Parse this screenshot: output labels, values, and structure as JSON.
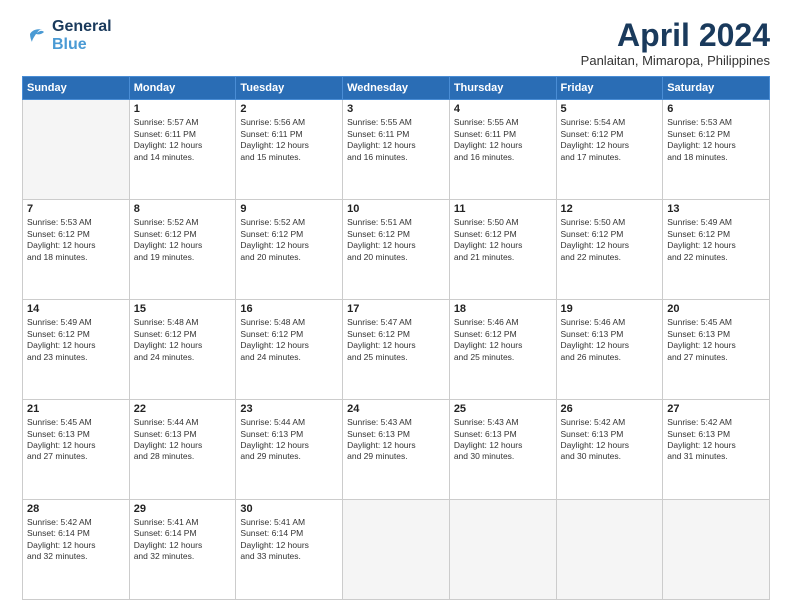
{
  "header": {
    "logo": {
      "line1": "General",
      "line2": "Blue"
    },
    "title": "April 2024",
    "location": "Panlaitan, Mimaropa, Philippines"
  },
  "weekdays": [
    "Sunday",
    "Monday",
    "Tuesday",
    "Wednesday",
    "Thursday",
    "Friday",
    "Saturday"
  ],
  "weeks": [
    [
      {
        "day": "",
        "info": ""
      },
      {
        "day": "1",
        "info": "Sunrise: 5:57 AM\nSunset: 6:11 PM\nDaylight: 12 hours\nand 14 minutes."
      },
      {
        "day": "2",
        "info": "Sunrise: 5:56 AM\nSunset: 6:11 PM\nDaylight: 12 hours\nand 15 minutes."
      },
      {
        "day": "3",
        "info": "Sunrise: 5:55 AM\nSunset: 6:11 PM\nDaylight: 12 hours\nand 16 minutes."
      },
      {
        "day": "4",
        "info": "Sunrise: 5:55 AM\nSunset: 6:11 PM\nDaylight: 12 hours\nand 16 minutes."
      },
      {
        "day": "5",
        "info": "Sunrise: 5:54 AM\nSunset: 6:12 PM\nDaylight: 12 hours\nand 17 minutes."
      },
      {
        "day": "6",
        "info": "Sunrise: 5:53 AM\nSunset: 6:12 PM\nDaylight: 12 hours\nand 18 minutes."
      }
    ],
    [
      {
        "day": "7",
        "info": "Sunrise: 5:53 AM\nSunset: 6:12 PM\nDaylight: 12 hours\nand 18 minutes."
      },
      {
        "day": "8",
        "info": "Sunrise: 5:52 AM\nSunset: 6:12 PM\nDaylight: 12 hours\nand 19 minutes."
      },
      {
        "day": "9",
        "info": "Sunrise: 5:52 AM\nSunset: 6:12 PM\nDaylight: 12 hours\nand 20 minutes."
      },
      {
        "day": "10",
        "info": "Sunrise: 5:51 AM\nSunset: 6:12 PM\nDaylight: 12 hours\nand 20 minutes."
      },
      {
        "day": "11",
        "info": "Sunrise: 5:50 AM\nSunset: 6:12 PM\nDaylight: 12 hours\nand 21 minutes."
      },
      {
        "day": "12",
        "info": "Sunrise: 5:50 AM\nSunset: 6:12 PM\nDaylight: 12 hours\nand 22 minutes."
      },
      {
        "day": "13",
        "info": "Sunrise: 5:49 AM\nSunset: 6:12 PM\nDaylight: 12 hours\nand 22 minutes."
      }
    ],
    [
      {
        "day": "14",
        "info": "Sunrise: 5:49 AM\nSunset: 6:12 PM\nDaylight: 12 hours\nand 23 minutes."
      },
      {
        "day": "15",
        "info": "Sunrise: 5:48 AM\nSunset: 6:12 PM\nDaylight: 12 hours\nand 24 minutes."
      },
      {
        "day": "16",
        "info": "Sunrise: 5:48 AM\nSunset: 6:12 PM\nDaylight: 12 hours\nand 24 minutes."
      },
      {
        "day": "17",
        "info": "Sunrise: 5:47 AM\nSunset: 6:12 PM\nDaylight: 12 hours\nand 25 minutes."
      },
      {
        "day": "18",
        "info": "Sunrise: 5:46 AM\nSunset: 6:12 PM\nDaylight: 12 hours\nand 25 minutes."
      },
      {
        "day": "19",
        "info": "Sunrise: 5:46 AM\nSunset: 6:13 PM\nDaylight: 12 hours\nand 26 minutes."
      },
      {
        "day": "20",
        "info": "Sunrise: 5:45 AM\nSunset: 6:13 PM\nDaylight: 12 hours\nand 27 minutes."
      }
    ],
    [
      {
        "day": "21",
        "info": "Sunrise: 5:45 AM\nSunset: 6:13 PM\nDaylight: 12 hours\nand 27 minutes."
      },
      {
        "day": "22",
        "info": "Sunrise: 5:44 AM\nSunset: 6:13 PM\nDaylight: 12 hours\nand 28 minutes."
      },
      {
        "day": "23",
        "info": "Sunrise: 5:44 AM\nSunset: 6:13 PM\nDaylight: 12 hours\nand 29 minutes."
      },
      {
        "day": "24",
        "info": "Sunrise: 5:43 AM\nSunset: 6:13 PM\nDaylight: 12 hours\nand 29 minutes."
      },
      {
        "day": "25",
        "info": "Sunrise: 5:43 AM\nSunset: 6:13 PM\nDaylight: 12 hours\nand 30 minutes."
      },
      {
        "day": "26",
        "info": "Sunrise: 5:42 AM\nSunset: 6:13 PM\nDaylight: 12 hours\nand 30 minutes."
      },
      {
        "day": "27",
        "info": "Sunrise: 5:42 AM\nSunset: 6:13 PM\nDaylight: 12 hours\nand 31 minutes."
      }
    ],
    [
      {
        "day": "28",
        "info": "Sunrise: 5:42 AM\nSunset: 6:14 PM\nDaylight: 12 hours\nand 32 minutes."
      },
      {
        "day": "29",
        "info": "Sunrise: 5:41 AM\nSunset: 6:14 PM\nDaylight: 12 hours\nand 32 minutes."
      },
      {
        "day": "30",
        "info": "Sunrise: 5:41 AM\nSunset: 6:14 PM\nDaylight: 12 hours\nand 33 minutes."
      },
      {
        "day": "",
        "info": ""
      },
      {
        "day": "",
        "info": ""
      },
      {
        "day": "",
        "info": ""
      },
      {
        "day": "",
        "info": ""
      }
    ]
  ]
}
